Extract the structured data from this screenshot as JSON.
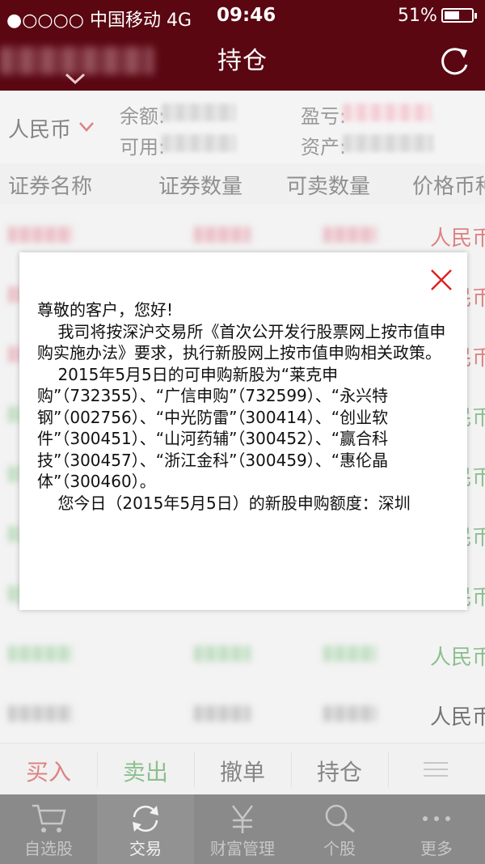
{
  "status": {
    "carrier": "●○○○○ 中国移动  4G",
    "time": "09:46",
    "battery": "51%"
  },
  "header": {
    "title": "持仓",
    "account_placeholder": ""
  },
  "summary": {
    "currency": "人民币",
    "balance_label": "余额:",
    "profit_label": "盈亏:",
    "available_label": "可用:",
    "assets_label": "资产:"
  },
  "columns": [
    "证券名称",
    "证券数量",
    "可卖数量",
    "价格币种"
  ],
  "rows": [
    {
      "currency": "人民币",
      "color": "red"
    },
    {
      "currency": "人民币",
      "color": "red"
    },
    {
      "currency": "人民币",
      "color": "red"
    },
    {
      "currency": "人民币",
      "color": "green"
    },
    {
      "currency": "人民币",
      "color": "green"
    },
    {
      "currency": "人民币",
      "color": "green"
    },
    {
      "currency": "人民币",
      "color": "green"
    },
    {
      "currency": "人民币",
      "color": "green"
    },
    {
      "currency": "人民币",
      "color": "black"
    }
  ],
  "actions": {
    "buy": "买入",
    "sell": "卖出",
    "cancel": "撤单",
    "hold": "持仓"
  },
  "tabs": [
    {
      "label": "自选股",
      "icon": "cart-icon"
    },
    {
      "label": "交易",
      "icon": "sync-icon"
    },
    {
      "label": "财富管理",
      "icon": "yen-icon"
    },
    {
      "label": "个股",
      "icon": "search-icon"
    },
    {
      "label": "更多",
      "icon": "more-icon"
    }
  ],
  "modal": {
    "message": "尊敬的客户，您好!\n    我司将按深沪交易所《首次公开发行股票网上按市值申购实施办法》要求，执行新股网上按市值申购相关政策。\n    2015年5月5日的可申购新股为“莱克申购”（732355）、“广信申购”（732599）、“永兴特钢”（002756）、“中光防雷”（300414）、“创业软件”（300451）、“山河药辅”（300452）、“赢合科技”（300457）、“浙江金科”（300459）、“惠伦晶体”（300460）。\n    您今日（2015年5月5日）的新股申购额度：深圳"
  },
  "colors": {
    "header": "#5a0712",
    "up": "#c31c1c",
    "down": "#2e8a35"
  }
}
